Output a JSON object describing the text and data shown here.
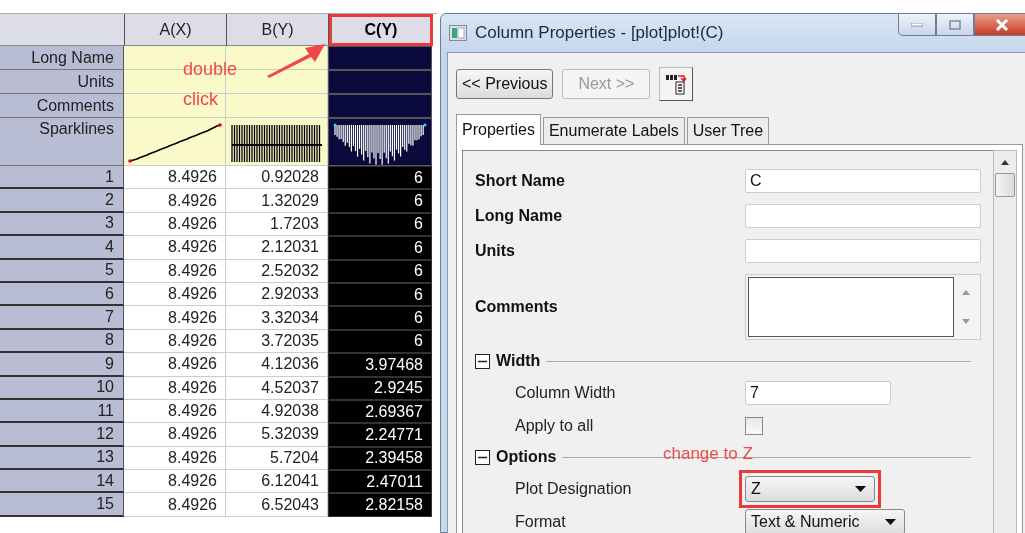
{
  "worksheet": {
    "columns": [
      {
        "header": "A(X)",
        "selected": false
      },
      {
        "header": "B(Y)",
        "selected": false
      },
      {
        "header": "C(Y)",
        "selected": true
      }
    ],
    "label_rows": [
      {
        "label": "Long Name",
        "kind": "text"
      },
      {
        "label": "Units",
        "kind": "text"
      },
      {
        "label": "Comments",
        "kind": "text"
      },
      {
        "label": "Sparklines",
        "kind": "sparkline"
      }
    ],
    "rows": [
      {
        "index": "1",
        "cells": [
          "8.4926",
          "0.92028",
          "6"
        ]
      },
      {
        "index": "2",
        "cells": [
          "8.4926",
          "1.32029",
          "6"
        ]
      },
      {
        "index": "3",
        "cells": [
          "8.4926",
          "1.7203",
          "6"
        ]
      },
      {
        "index": "4",
        "cells": [
          "8.4926",
          "2.12031",
          "6"
        ]
      },
      {
        "index": "5",
        "cells": [
          "8.4926",
          "2.52032",
          "6"
        ]
      },
      {
        "index": "6",
        "cells": [
          "8.4926",
          "2.92033",
          "6"
        ]
      },
      {
        "index": "7",
        "cells": [
          "8.4926",
          "3.32034",
          "6"
        ]
      },
      {
        "index": "8",
        "cells": [
          "8.4926",
          "3.72035",
          "6"
        ]
      },
      {
        "index": "9",
        "cells": [
          "8.4926",
          "4.12036",
          "3.97468"
        ]
      },
      {
        "index": "10",
        "cells": [
          "8.4926",
          "4.52037",
          "2.9245"
        ]
      },
      {
        "index": "11",
        "cells": [
          "8.4926",
          "4.92038",
          "2.69367"
        ]
      },
      {
        "index": "12",
        "cells": [
          "8.4926",
          "5.32039",
          "2.24771"
        ]
      },
      {
        "index": "13",
        "cells": [
          "8.4926",
          "5.7204",
          "2.39458"
        ]
      },
      {
        "index": "14",
        "cells": [
          "8.4926",
          "6.12041",
          "2.47011"
        ]
      },
      {
        "index": "15",
        "cells": [
          "8.4926",
          "6.52043",
          "2.82158"
        ]
      }
    ],
    "note": [
      "double",
      "click"
    ]
  },
  "dialog": {
    "title": "Column Properties - [plot]plot!(C)",
    "buttons": [
      {
        "label": "<< Previous",
        "disabled": false
      },
      {
        "label": "Next >>",
        "disabled": true
      }
    ],
    "tabs": [
      {
        "label": "Properties",
        "selected": true
      },
      {
        "label": "Enumerate Labels",
        "selected": false
      },
      {
        "label": "User Tree",
        "selected": false
      }
    ],
    "fields": [
      {
        "kind": "text",
        "label": "Short Name",
        "value": "C"
      },
      {
        "kind": "text",
        "label": "Long Name"
      },
      {
        "kind": "text",
        "label": "Units"
      },
      {
        "kind": "textarea",
        "label": "Comments"
      }
    ],
    "sections": [
      {
        "title": "Width",
        "expanded": true,
        "items": [
          {
            "kind": "text",
            "label": "Column Width",
            "value": "7",
            "highlighted": false
          },
          {
            "kind": "checkbox",
            "label": "Apply to all",
            "checked": false,
            "highlighted": false
          }
        ]
      },
      {
        "title": "Options",
        "expanded": true,
        "note": "change to Z",
        "items": [
          {
            "kind": "dropdown",
            "label": "Plot Designation",
            "value": "Z",
            "highlighted": true
          },
          {
            "kind": "dropdown",
            "label": "Format",
            "value": "Text & Numeric",
            "highlighted": false
          }
        ]
      }
    ]
  }
}
